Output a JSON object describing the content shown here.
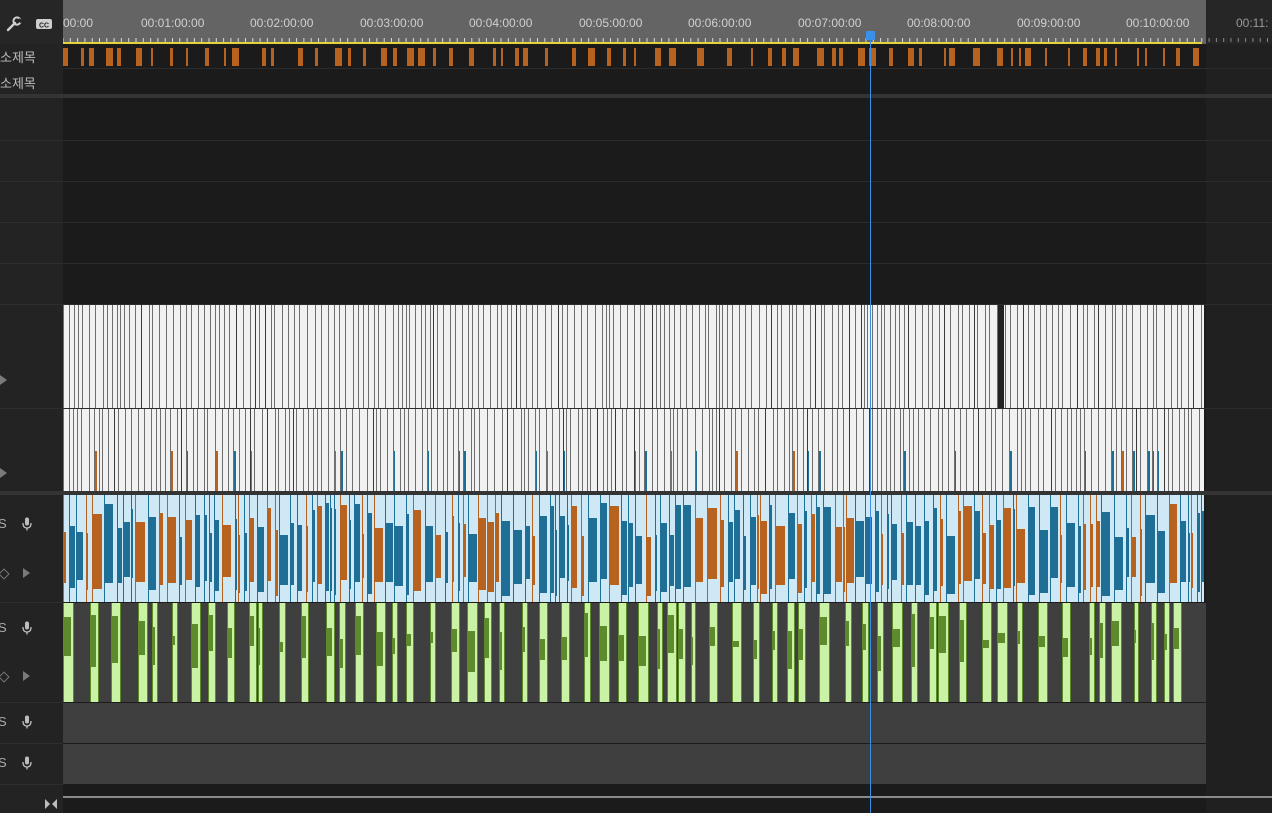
{
  "timeline": {
    "ruler": {
      "labels": [
        "00:00",
        "00:01:00:00",
        "00:02:00:00",
        "00:03:00:00",
        "00:04:00:00",
        "00:05:00:00",
        "00:06:00:00",
        "00:07:00:00",
        "00:08:00:00",
        "00:09:00:00",
        "00:10:00:00",
        "00:11:"
      ]
    },
    "tracks": {
      "subtitle_1": "소제목",
      "subtitle_2": "소제목",
      "audio_labels": [
        "S",
        "S",
        "S",
        "S"
      ]
    },
    "playhead_time": "00:07:22:00",
    "icons": [
      "wrench-icon",
      "captions-icon",
      "mic-icon",
      "chevron-right-icon",
      "keyframe-diamond-icon",
      "zoom-fit-icon"
    ],
    "colors": {
      "playhead": "#3a8fe8",
      "in_out_bar": "#e4d33b",
      "subtitle_clip": "#b8621f",
      "video_clip": "#ededed",
      "audio_blue": "#1f6e96",
      "audio_orange": "#b8621f",
      "audio_green": "#5d8a2a"
    }
  }
}
